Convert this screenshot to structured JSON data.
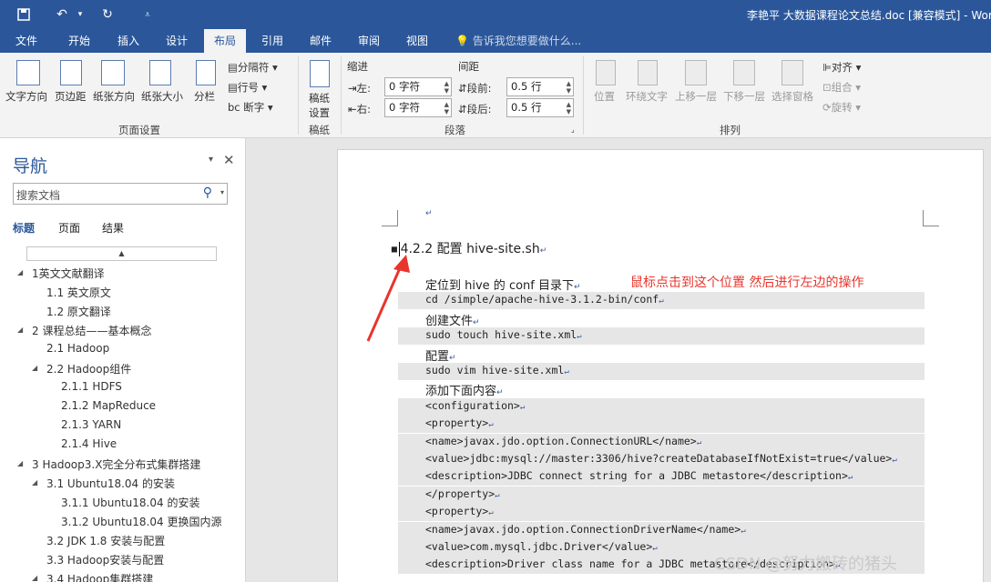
{
  "window": {
    "title": "李艳平 大数据课程论文总结.doc [兼容模式] - Wor"
  },
  "tabs": [
    "文件",
    "开始",
    "插入",
    "设计",
    "布局",
    "引用",
    "邮件",
    "审阅",
    "视图"
  ],
  "tell_me": "告诉我您想要做什么...",
  "ribbon": {
    "page_setup": {
      "text_dir": "文字方向",
      "margins": "页边距",
      "orientation": "纸张方向",
      "size": "纸张大小",
      "columns": "分栏",
      "breaks": "分隔符",
      "line_numbers": "行号",
      "hyphen": "断字",
      "group": "页面设置"
    },
    "draft": {
      "label1": "稿纸",
      "label2": "设置",
      "group": "稿纸"
    },
    "paragraph": {
      "indent_title": "缩进",
      "spacing_title": "间距",
      "left_label": "左:",
      "right_label": "右:",
      "left_value": "0 字符",
      "right_value": "0 字符",
      "before_label": "段前:",
      "after_label": "段后:",
      "before_value": "0.5 行",
      "after_value": "0.5 行",
      "group": "段落"
    },
    "arrange": {
      "position": "位置",
      "wrap": "环绕文字",
      "forward": "上移一层",
      "backward": "下移一层",
      "selection": "选择窗格",
      "align": "对齐",
      "group_items": "组合",
      "rotate": "旋转",
      "group": "排列"
    }
  },
  "nav": {
    "title": "导航",
    "search_placeholder": "搜索文档",
    "tabs": [
      "标题",
      "页面",
      "结果"
    ],
    "items": [
      {
        "text": "1英文文献翻译"
      },
      {
        "text": "1.1 英文原文"
      },
      {
        "text": "1.2 原文翻译"
      },
      {
        "text": "2 课程总结——基本概念"
      },
      {
        "text": "2.1 Hadoop"
      },
      {
        "text": "2.2 Hadoop组件"
      },
      {
        "text": "2.1.1 HDFS"
      },
      {
        "text": "2.1.2 MapReduce"
      },
      {
        "text": "2.1.3 YARN"
      },
      {
        "text": "2.1.4 Hive"
      },
      {
        "text": "3 Hadoop3.X完全分布式集群搭建"
      },
      {
        "text": "3.1 Ubuntu18.04 的安装"
      },
      {
        "text": "3.1.1 Ubuntu18.04 的安装"
      },
      {
        "text": "3.1.2 Ubuntu18.04 更换国内源"
      },
      {
        "text": "3.2 JDK 1.8 安装与配置"
      },
      {
        "text": "3.3 Hadoop安装与配置"
      },
      {
        "text": "3.4 Hadoop集群搭建"
      }
    ]
  },
  "doc": {
    "heading": "4.2.2 配置 hive-site.sh",
    "annotation": "鼠标点击到这个位置 然后进行左边的操作",
    "lines": [
      {
        "text": "定位到 hive 的 conf 目录下",
        "code": false
      },
      {
        "text": "cd /simple/apache-hive-3.1.2-bin/conf",
        "code": true
      },
      {
        "text": "创建文件",
        "code": false
      },
      {
        "text": "sudo touch hive-site.xml",
        "code": true
      },
      {
        "text": "配置",
        "code": false
      },
      {
        "text": "sudo vim hive-site.xml",
        "code": true
      },
      {
        "text": "添加下面内容",
        "code": false
      },
      {
        "text": "<configuration>",
        "code": true
      },
      {
        "text": "<property>",
        "code": true
      },
      {
        "text": "<name>javax.jdo.option.ConnectionURL</name>",
        "code": true
      },
      {
        "text": "<value>jdbc:mysql://master:3306/hive?createDatabaseIfNotExist=true</value>",
        "code": true
      },
      {
        "text": "<description>JDBC connect string for a JDBC metastore</description>",
        "code": true
      },
      {
        "text": "</property>",
        "code": true
      },
      {
        "text": "<property>",
        "code": true
      },
      {
        "text": "<name>javax.jdo.option.ConnectionDriverName</name>",
        "code": true
      },
      {
        "text": "<value>com.mysql.jdbc.Driver</value>",
        "code": true
      },
      {
        "text": "<description>Driver class name for a JDBC metastore</description>",
        "code": true
      }
    ]
  },
  "watermark": "CSDN @努力搬砖的猪头"
}
